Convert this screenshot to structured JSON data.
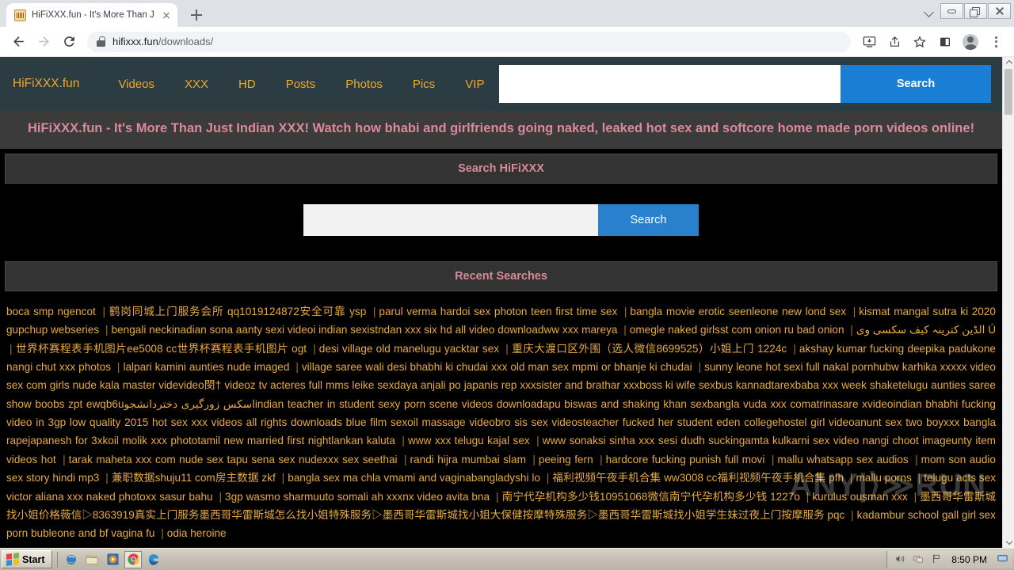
{
  "browser": {
    "tab": {
      "title": "HiFiXXX.fun - It's More Than Just Ind",
      "favicon": "keyboard-icon"
    },
    "new_tab_label": "+",
    "url_host": "hifixxx.fun",
    "url_path": "/downloads/",
    "window_controls": {
      "minimize": "minimize-icon",
      "maximize": "maximize-icon",
      "close": "close-icon"
    },
    "toolbar_icons": [
      "back-icon",
      "forward-icon",
      "reload-icon",
      "install-icon",
      "share-icon",
      "bookmark-star-icon",
      "side-panel-icon",
      "profile-avatar",
      "more-menu-icon"
    ]
  },
  "site": {
    "nav": [
      {
        "label": "HiFiXXX.fun"
      },
      {
        "label": "Videos"
      },
      {
        "label": "XXX"
      },
      {
        "label": "HD"
      },
      {
        "label": "Posts"
      },
      {
        "label": "Photos"
      },
      {
        "label": "Pics"
      },
      {
        "label": "VIP"
      }
    ],
    "top_search": {
      "value": "",
      "placeholder": "",
      "button": "Search"
    },
    "tagline": "HiFiXXX.fun - It's More Than Just Indian XXX! Watch how bhabi and girlfriends going naked, leaked hot sex and softcore home made porn videos online!",
    "search_section_title": "Search HiFiXXX",
    "main_search": {
      "value": "",
      "placeholder": "",
      "button": "Search"
    },
    "recent_section_title": "Recent Searches",
    "recent_searches": [
      "boca smp ngencot",
      "鹤岗同城上门服务会所 qq1019124872安全可靠 ysp",
      "parul verma hardoi sex photon teen first time sex",
      "bangla movie erotic seenleone new lond sex",
      "kismat mangal sutra ki 2020 gupchup webseries",
      "bengali neckinadian sona aanty sexi videoi indian sexistndan xxx six hd all video downloadww xxx mareya",
      "omegle naked girlsst com onion ru bad onion",
      "الڈین کترینہ کیف سکسی وی Ú",
      "世界杯赛程表手机图片ee5008 cc世界杯赛程表手机图片 ogt",
      "desi village old manelugu yacktar sex",
      "重庆大渡口区外围（选人微信8699525）小姐上门 1224c",
      "akshay kumar fucking deepika padukone nangi chut xxx photos",
      "lalpari kamini aunties nude imaged",
      "village saree wali desi bhabhi ki chudai xxx old man sex mpmi or bhanje ki chudai",
      "sunny leone hot sexi full nakal pornhubw karhika xxxxx video sex com girls nude kala master videvideo閔† videoz tv acteres full mms leike sexdaya anjali po japanis rep xxxsister and brathar xxxboss ki wife sexbus kannadtarexbaba xxx week shaketelugu aunties saree show boobs zpt ewqb6uاسکس زورگیری دختردانشجوindian teacher in student sexy porn scene videos downloadapu biswas and shaking khan sexbangla vuda xxx comatrinasare xvideoindian bhabhi fucking video in 3gp low quality 2015 hot sex xxx videos all rights downloads blue film sexoil massage videobro sis sex videosteacher fucked her student eden collegehostel girl videoanunt sex two boyxxx bangla rapejapanesh for 3xkoil molik xxx phototamil new married first nightlankan kaluta",
      "www xxx telugu kajal sex",
      "www sonaksi sinha xxx sesi dudh suckingamta kulkarni sex video nangi choot imageunty item videos hot",
      "tarak maheta xxx com nude sex tapu sena sex nudexxx sex seethai",
      "randi hijra mumbai slam",
      "peeing fern",
      "hardcore fucking punish full movi",
      "mallu whatsapp sex audios",
      "mom son audio sex story hindi mp3",
      "兼职数据shuju11 com房主数据 zkf",
      "bangla sex ma chla vmami and vaginabangladyshi lo",
      "福利视频午夜手机合集 ww3008 cc福利视频午夜手机合集 pfh",
      "mallu porns",
      "telugu acts sex victor aliana xxx naked photoxx sasur bahu",
      "3gp wasmo sharmuuto somali ah xxxnx video avita bna",
      "南宁代孕机构多少钱10951068微信南宁代孕机构多少钱 1227o",
      "kurulus ousman xxx",
      "墨西哥华雷斯城找小姐价格薇信▷8363919真实上门服务墨西哥华雷斯城怎么找小姐特殊服务▷墨西哥华雷斯城找小姐大保健按摩特殊服务▷墨西哥华雷斯城找小姐学生妹过夜上门按摩服务 pqc",
      "kadambur school gall girl sex porn bubleone and bf vagina fu",
      "odia heroine"
    ],
    "watermark": "ANY  RUN",
    "colors": {
      "nav_bg": "#2b3c42",
      "nav_link": "#f0a830",
      "accent_pink": "#d98a9a",
      "search_blue": "#1a7fd4",
      "link_orange": "#e8a93f",
      "page_bg": "#000000"
    }
  },
  "taskbar": {
    "start_label": "Start",
    "quick_launch": [
      "internet-explorer-icon",
      "folder-icon",
      "media-player-icon",
      "chrome-icon",
      "edge-icon"
    ],
    "tray": [
      "volume-icon",
      "network-icon",
      "flag-icon"
    ],
    "clock": "8:50 PM",
    "show_desktop": "show-desktop-icon"
  }
}
